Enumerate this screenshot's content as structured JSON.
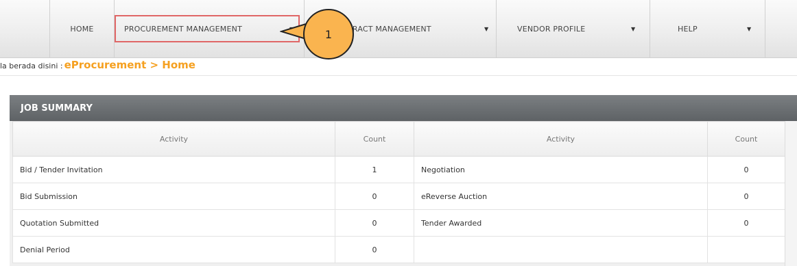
{
  "nav": {
    "home": "HOME",
    "procurement": "PROCUREMENT MANAGEMENT",
    "contract": "TRACT MANAGEMENT",
    "vendor": "VENDOR PROFILE",
    "help": "HELP",
    "dropdown_icon": "triangle-down"
  },
  "callout": {
    "number": "1",
    "color": "#fab44f",
    "highlight_color": "#e06666"
  },
  "breadcrumb": {
    "prefix": "la berada disini :",
    "path": "eProcurement > Home",
    "path_color": "#f5a020"
  },
  "job_summary": {
    "title": "JOB SUMMARY",
    "headers": {
      "activity": "Activity",
      "count": "Count"
    },
    "rows": [
      {
        "left_activity": "Bid / Tender Invitation",
        "left_count": "1",
        "right_activity": "Negotiation",
        "right_count": "0"
      },
      {
        "left_activity": "Bid Submission",
        "left_count": "0",
        "right_activity": "eReverse Auction",
        "right_count": "0"
      },
      {
        "left_activity": "Quotation Submitted",
        "left_count": "0",
        "right_activity": "Tender Awarded",
        "right_count": "0"
      },
      {
        "left_activity": "Denial Period",
        "left_count": "0",
        "right_activity": "",
        "right_count": ""
      }
    ]
  }
}
